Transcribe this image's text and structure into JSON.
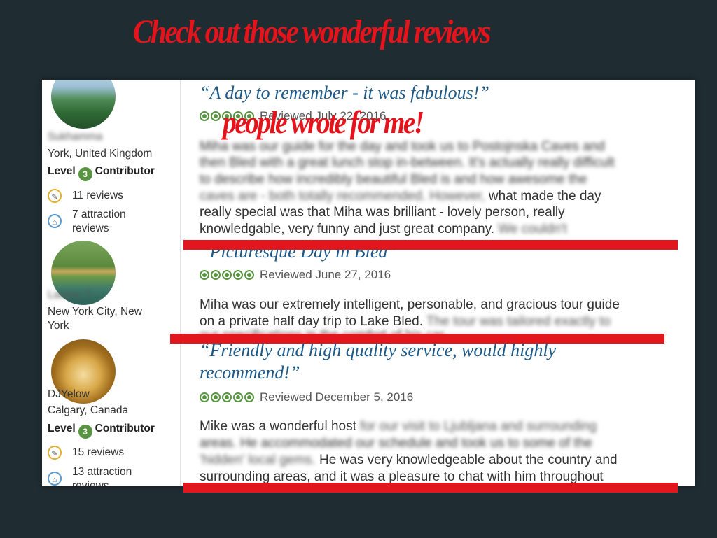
{
  "slide": {
    "title": "Check out those wonderful reviews",
    "subtitle": "people wrote for me!"
  },
  "colors": {
    "background": "#1f2c32",
    "accent_red": "#e5131b",
    "title_blue": "#1d5a88",
    "bubble_green": "#589442"
  },
  "reviewers": [
    {
      "username": "Sukhamma",
      "location": "York, United Kingdom",
      "level_prefix": "Level",
      "level": "3",
      "level_suffix": "Contributor",
      "reviews_count": "11 reviews",
      "attraction_line1": "7 attraction",
      "attraction_line2": "reviews"
    },
    {
      "username": "Lauren T",
      "location_line1": "New York City, New",
      "location_line2": "York"
    },
    {
      "username": "DJYelow",
      "location": "Calgary, Canada",
      "level_prefix": "Level",
      "level": "3",
      "level_suffix": "Contributor",
      "reviews_count": "15 reviews",
      "attraction_line1": "13 attraction",
      "attraction_line2": "reviews"
    }
  ],
  "reviews": [
    {
      "title": "“A day to remember - it was fabulous!”",
      "date": "Reviewed July 22, 2016",
      "blur_1": "Miha was our guide for the day and took us to Postojnska Caves and",
      "blur_2": "then Bled with a great lunch stop in-between. It's actually really difficult",
      "blur_3": "to describe how incredibly beautiful Bled is and how awesome the",
      "blur_4": "caves are - both totally recommended. However,",
      "line_4": "what made the day",
      "line_5": "really special was that Miha was brilliant - lovely person, really",
      "line_6": "knowledgable, very funny and just great company.",
      "line_6_blur": "We couldn't"
    },
    {
      "title": "“Picturesque Day in Bled”",
      "date": "Reviewed June 27, 2016",
      "line_1": "Miha was our extremely intelligent, personable, and gracious tour guide",
      "line_2": "on a private half day trip to Lake Bled.",
      "line_2_blur": "The tour was tailored exactly to",
      "blur_3": "our specifications in the comfort of his car"
    },
    {
      "title_line1": "“Friendly and high quality service, would highly",
      "title_line2": "recommend!”",
      "date": "Reviewed December 5, 2016",
      "line_1": "Mike was a wonderful host",
      "line_1_blur": "for our visit to Ljubljana and surrounding",
      "blur_2": "areas. He accommodated our schedule and took us to some of the",
      "blur_3": "'hidden' local gems.",
      "line_3": "He was very knowledgeable about the country and",
      "line_4": "surrounding areas, and it was a pleasure to chat with him throughout"
    }
  ]
}
